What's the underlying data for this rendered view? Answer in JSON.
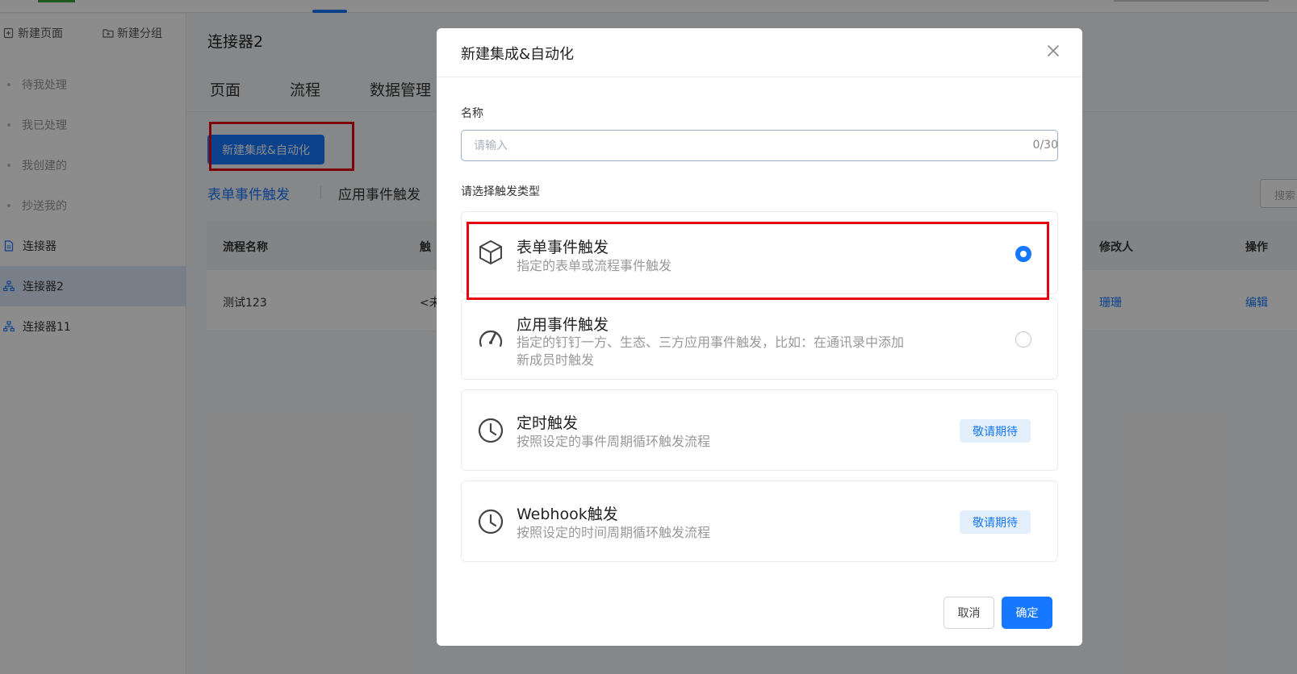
{
  "sidebar": {
    "new_page": "新建页面",
    "new_group": "新建分组",
    "items": [
      {
        "label": "待我处理"
      },
      {
        "label": "我已处理"
      },
      {
        "label": "我创建的"
      },
      {
        "label": "抄送我的"
      }
    ],
    "connectors": [
      {
        "label": "连接器"
      },
      {
        "label": "连接器2"
      },
      {
        "label": "连接器11"
      }
    ]
  },
  "main": {
    "title": "连接器2",
    "tabs": [
      "页面",
      "流程",
      "数据管理"
    ],
    "new_button": "新建集成&自动化",
    "sub_tabs": [
      "表单事件触发",
      "应用事件触发"
    ],
    "search_stub": "搜索",
    "table": {
      "headers": [
        "流程名称",
        "触",
        "修改人",
        "操作"
      ],
      "rows": [
        {
          "name": "测试123",
          "trigger": "<未",
          "modifier": "珊珊",
          "action": "编辑"
        }
      ]
    }
  },
  "modal": {
    "title": "新建集成&自动化",
    "name_label": "名称",
    "name_placeholder": "请输入",
    "name_counter": "0/30",
    "trigger_label": "请选择触发类型",
    "options": [
      {
        "title": "表单事件触发",
        "desc": "指定的表单或流程事件触发",
        "icon": "cube-icon",
        "selected": true
      },
      {
        "title": "应用事件触发",
        "desc": "指定的钉钉一方、生态、三方应用事件触发，比如：在通讯录中添加新成员时触发",
        "icon": "gauge-icon",
        "selected": false
      },
      {
        "title": "定时触发",
        "desc": "按照设定的事件周期循环触发流程",
        "icon": "clock-icon",
        "badge": "敬请期待"
      },
      {
        "title": "Webhook触发",
        "desc": "按照设定的时间周期循环触发流程",
        "icon": "clock-icon",
        "badge": "敬请期待"
      }
    ],
    "cancel": "取消",
    "confirm": "确定"
  },
  "colors": {
    "primary": "#1677ff",
    "highlight": "#e60012"
  }
}
